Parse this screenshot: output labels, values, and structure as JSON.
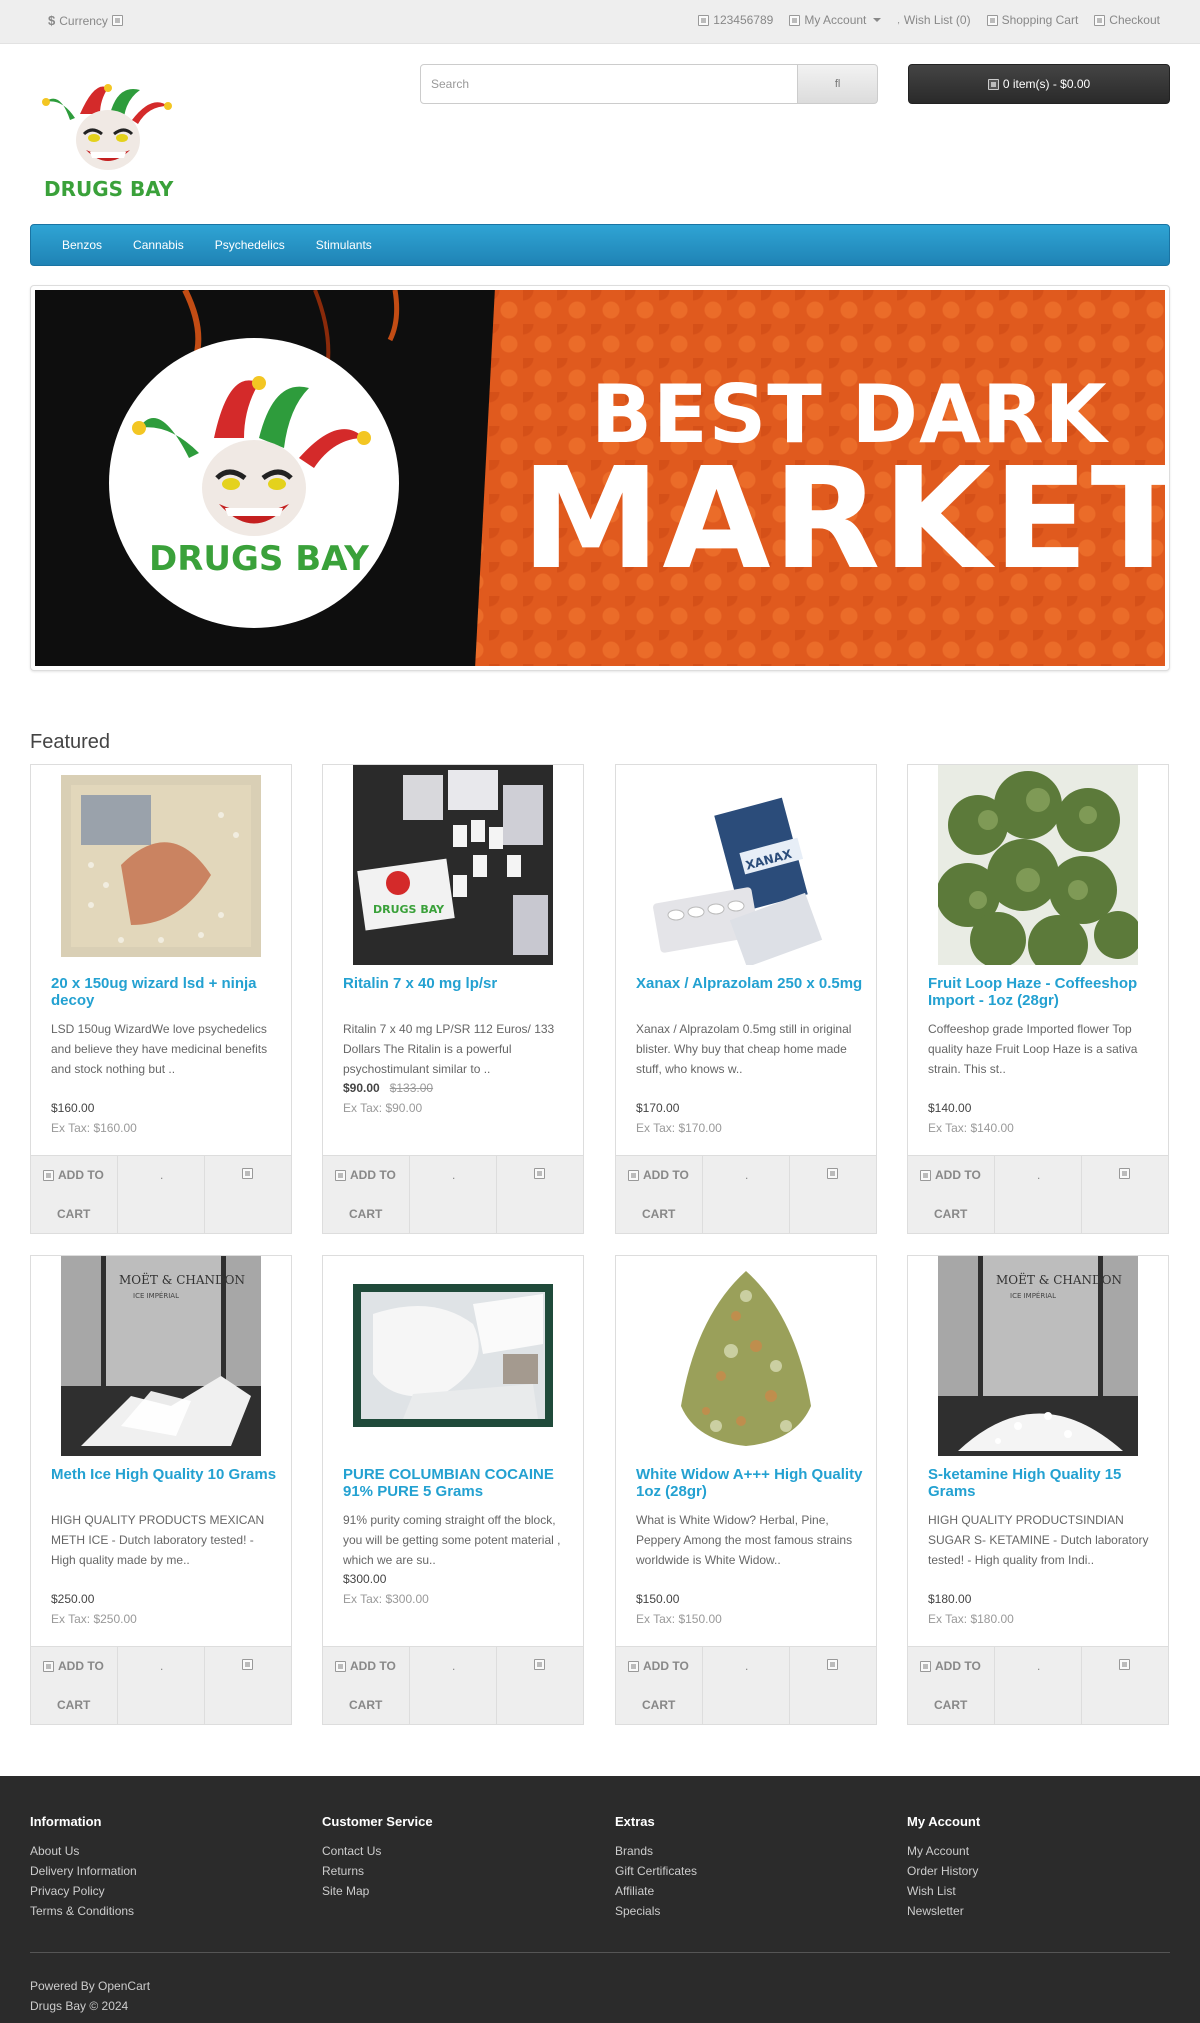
{
  "topbar": {
    "currency_symbol": "$",
    "currency_label": "Currency",
    "phone": "123456789",
    "my_account": "My Account",
    "wish_list": "Wish List (0)",
    "shopping_cart": "Shopping Cart",
    "checkout": "Checkout"
  },
  "header": {
    "logo_text": "DRUGS BAY",
    "search_placeholder": "Search",
    "cart_label": "0 item(s) - $0.00"
  },
  "nav": [
    "Benzos",
    "Cannabis",
    "Psychedelics",
    "Stimulants"
  ],
  "banner": {
    "logo_text": "DRUGS BAY",
    "line1": "BEST DARK",
    "line2": "MARKET"
  },
  "featured": {
    "title": "Featured",
    "add_to_cart_1": "ADD TO",
    "add_to_cart_2": "CART",
    "products": [
      {
        "name": "20 x 150ug wizard lsd + ninja decoy",
        "desc": "LSD 150ug WizardWe love psychedelics and believe they have medicinal benefits and stock nothing but ..",
        "price": "$160.00",
        "old_price": "",
        "tax": "Ex Tax: $160.00"
      },
      {
        "name": "Ritalin 7 x 40 mg lp/sr",
        "desc": "Ritalin 7 x 40 mg LP/SR 112 Euros/ 133 Dollars The Ritalin is a powerful psychostimulant similar to ..",
        "price": "$90.00",
        "old_price": "$133.00",
        "tax": "Ex Tax: $90.00"
      },
      {
        "name": "Xanax / Alprazolam 250 x 0.5mg",
        "desc": "Xanax / Alprazolam 0.5mg still in original blister. Why buy that cheap home made stuff, who knows w..",
        "price": "$170.00",
        "old_price": "",
        "tax": "Ex Tax: $170.00"
      },
      {
        "name": "Fruit Loop Haze - Coffeeshop Import - 1oz (28gr)",
        "desc": "Coffeeshop grade Imported flower Top quality haze Fruit Loop Haze is a sativa strain. This st..",
        "price": "$140.00",
        "old_price": "",
        "tax": "Ex Tax: $140.00"
      },
      {
        "name": "Meth Ice High Quality 10 Grams",
        "desc": "HIGH QUALITY PRODUCTS MEXICAN METH ICE - Dutch laboratory tested! - High quality made by me..",
        "price": "$250.00",
        "old_price": "",
        "tax": "Ex Tax: $250.00"
      },
      {
        "name": "PURE COLUMBIAN COCAINE 91% PURE 5 Grams",
        "desc": "91% purity coming straight off the block, you will be getting some potent material , which we are su..",
        "price": "$300.00",
        "old_price": "",
        "tax": "Ex Tax: $300.00"
      },
      {
        "name": "White Widow A+++ High Quality 1oz (28gr)",
        "desc": "What is White Widow? Herbal, Pine, Peppery Among the most famous strains worldwide is White Widow..",
        "price": "$150.00",
        "old_price": "",
        "tax": "Ex Tax: $150.00"
      },
      {
        "name": "S-ketamine High Quality 15 Grams",
        "desc": "HIGH QUALITY PRODUCTSINDIAN SUGAR S- KETAMINE - Dutch laboratory tested! - High quality from Indi..",
        "price": "$180.00",
        "old_price": "",
        "tax": "Ex Tax: $180.00"
      }
    ]
  },
  "product_images": {
    "bottle_brand": "MOËT & CHANDON",
    "bottle_sub": "ICE IMPÉRIAL",
    "pack_text": "XANAX"
  },
  "footer": {
    "columns": [
      {
        "title": "Information",
        "links": [
          "About Us",
          "Delivery Information",
          "Privacy Policy",
          "Terms & Conditions"
        ]
      },
      {
        "title": "Customer Service",
        "links": [
          "Contact Us",
          "Returns",
          "Site Map"
        ]
      },
      {
        "title": "Extras",
        "links": [
          "Brands",
          "Gift Certificates",
          "Affiliate",
          "Specials"
        ]
      },
      {
        "title": "My Account",
        "links": [
          "My Account",
          "Order History",
          "Wish List",
          "Newsletter"
        ]
      }
    ],
    "powered_by": "Powered By",
    "opencart": "OpenCart",
    "copyright": "Drugs Bay © 2024"
  }
}
